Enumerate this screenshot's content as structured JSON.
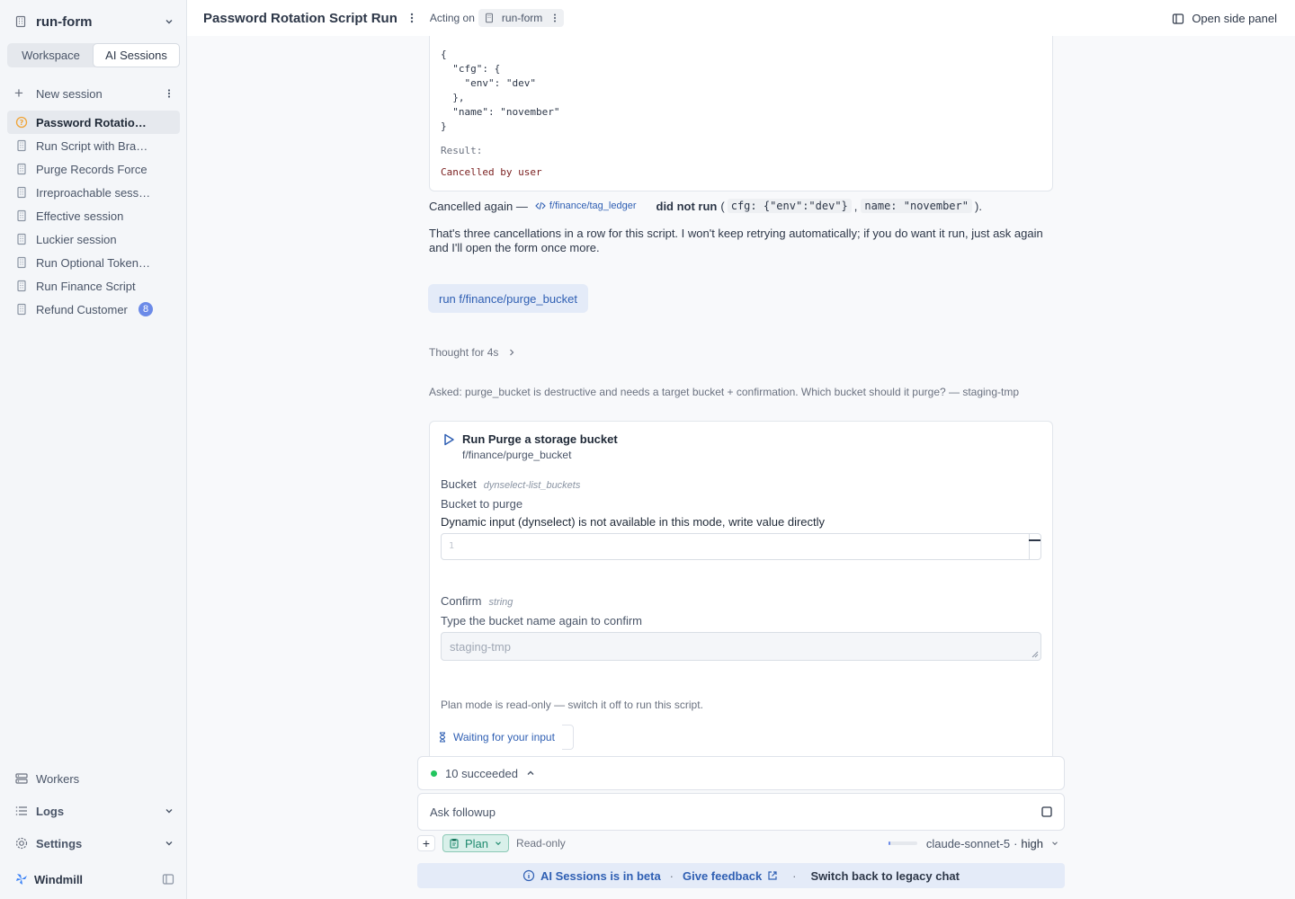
{
  "sidebar": {
    "workspace_name": "run-form",
    "tabs": [
      "Workspace",
      "AI Sessions"
    ],
    "new_session_label": "New session",
    "sessions": [
      {
        "label": "Password Rotation Script Run",
        "active": true,
        "status": "pending"
      },
      {
        "label": "Run Script with Branch",
        "active": false
      },
      {
        "label": "Purge Records Force",
        "active": false
      },
      {
        "label": "Irreproachable session",
        "active": false
      },
      {
        "label": "Effective session",
        "active": false
      },
      {
        "label": "Luckier session",
        "active": false
      },
      {
        "label": "Run Optional Token Script",
        "active": false
      },
      {
        "label": "Run Finance Script",
        "active": false
      },
      {
        "label": "Refund Customer",
        "active": false,
        "badge": "8"
      }
    ],
    "bottom": {
      "workers": "Workers",
      "logs": "Logs",
      "settings": "Settings",
      "brand": "Windmill"
    }
  },
  "topbar": {
    "title": "Password Rotation Script Run",
    "acting_on": "Acting on",
    "workspace_chip": "run-form",
    "side_panel": "Open side panel"
  },
  "chat": {
    "prev_card": {
      "args_json": "{\n  \"cfg\": {\n    \"env\": \"dev\"\n  },\n  \"name\": \"november\"\n}",
      "result_label": "Result:",
      "result_value": "Cancelled by user"
    },
    "cancel_line": {
      "prefix": "Cancelled again —",
      "script_path": "f/finance/tag_ledger",
      "did_not_run": "did not run",
      "open_paren": "(",
      "arg1": "cfg: {\"env\":\"dev\"}",
      "comma": ",",
      "arg2": "name: \"november\"",
      "close": ")."
    },
    "assistant_note": "That's three cancellations in a row for this script. I won't keep retrying automatically; if you do want it run, just ask again and I'll open the form once more.",
    "user_message": "run f/finance/purge_bucket",
    "thought": "Thought for 4s",
    "asked": "Asked: purge_bucket is destructive and needs a target bucket + confirmation. Which bucket should it purge? — staging-tmp",
    "run_card": {
      "title": "Run Purge a storage bucket",
      "path": "f/finance/purge_bucket",
      "field1": {
        "label": "Bucket",
        "type": "dynselect-list_buckets",
        "description": "Bucket to purge",
        "note": "Dynamic input (dynselect) is not available in this mode, write value directly",
        "line_number": "1"
      },
      "field2": {
        "label": "Confirm",
        "type": "string",
        "description": "Type the bucket name again to confirm",
        "placeholder": "staging-tmp"
      },
      "plan_note": "Plan mode is read-only — switch it off to run this script.",
      "waiting": "Waiting for your input"
    }
  },
  "composer": {
    "status": "10 succeeded",
    "placeholder": "Ask followup",
    "mode": "Plan",
    "readonly": "Read-only",
    "model": "claude-sonnet-5",
    "effort": "high",
    "context_fill": 0.06
  },
  "beta_bar": {
    "beta_text": "AI Sessions is in beta",
    "feedback": "Give feedback",
    "switch_back": "Switch back to legacy chat"
  },
  "colors": {
    "accent": "#2f5fb3",
    "pending": "#f0a437",
    "success": "#22c55e",
    "badge": "#6b8ae8",
    "plan_bg": "#d9f0ea",
    "plan_fg": "#1e8a6e"
  }
}
